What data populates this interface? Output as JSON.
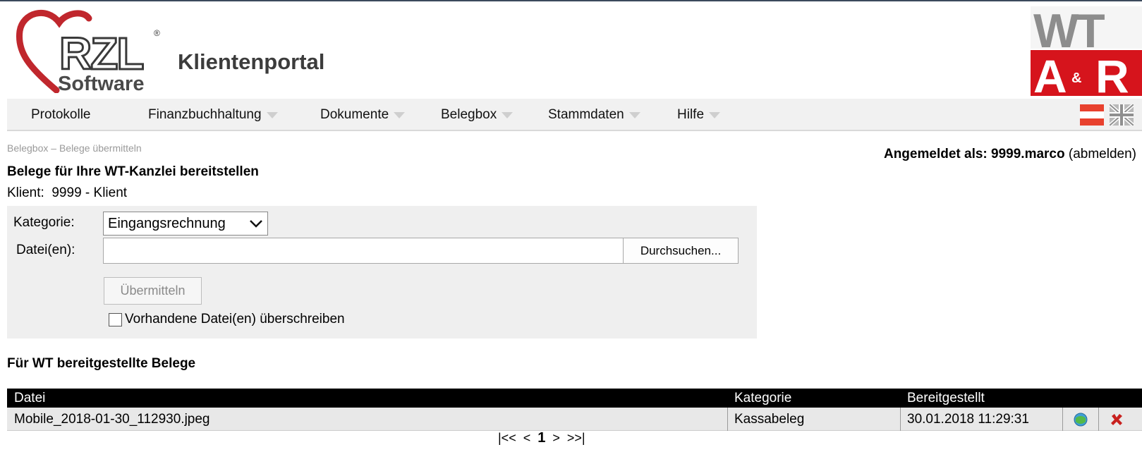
{
  "header": {
    "logo_text": "RZL",
    "logo_registered": "®",
    "logo_subtext": "Software",
    "portal_title": "Klientenportal",
    "partner_logo_text": "WT A&R"
  },
  "nav": {
    "items": [
      {
        "label": "Protokolle",
        "has_dropdown": false
      },
      {
        "label": "Finanzbuchhaltung",
        "has_dropdown": true
      },
      {
        "label": "Dokumente",
        "has_dropdown": true
      },
      {
        "label": "Belegbox",
        "has_dropdown": true
      },
      {
        "label": "Stammdaten",
        "has_dropdown": true
      },
      {
        "label": "Hilfe",
        "has_dropdown": true
      }
    ],
    "languages": [
      "austria-flag-icon",
      "uk-flag-icon"
    ]
  },
  "breadcrumb": "Belegbox – Belege übermitteln",
  "login": {
    "prefix": "Angemeldet als: ",
    "user": "9999.marco",
    "logout": "(abmelden)"
  },
  "page_title": "Belege für Ihre WT-Kanzlei bereitstellen",
  "client": "Klient:  9999 - Klient",
  "form": {
    "category_label": "Kategorie:",
    "category_value": "Eingangsrechnung",
    "files_label": "Datei(en):",
    "files_value": "",
    "browse_label": "Durchsuchen...",
    "submit_label": "Übermitteln",
    "overwrite_label": "Vorhandene Datei(en) überschreiben",
    "overwrite_checked": false
  },
  "section_title": "Für WT bereitgestellte Belege",
  "table": {
    "columns": [
      "Datei",
      "Kategorie",
      "Bereitgestellt"
    ],
    "rows": [
      {
        "file": "Mobile_2018-01-30_112930.jpeg",
        "category": "Kassabeleg",
        "date": "30.01.2018 11:29:31"
      }
    ]
  },
  "pager": {
    "first": "|<<",
    "prev": "<",
    "current": "1",
    "next": ">",
    "last": ">>|"
  },
  "colors": {
    "logo_heart": "#c0272d",
    "nav_bg": "#f1f1f1",
    "table_header_bg": "#000000",
    "delete_red": "#c8201e",
    "partner_red": "#d6141c"
  }
}
